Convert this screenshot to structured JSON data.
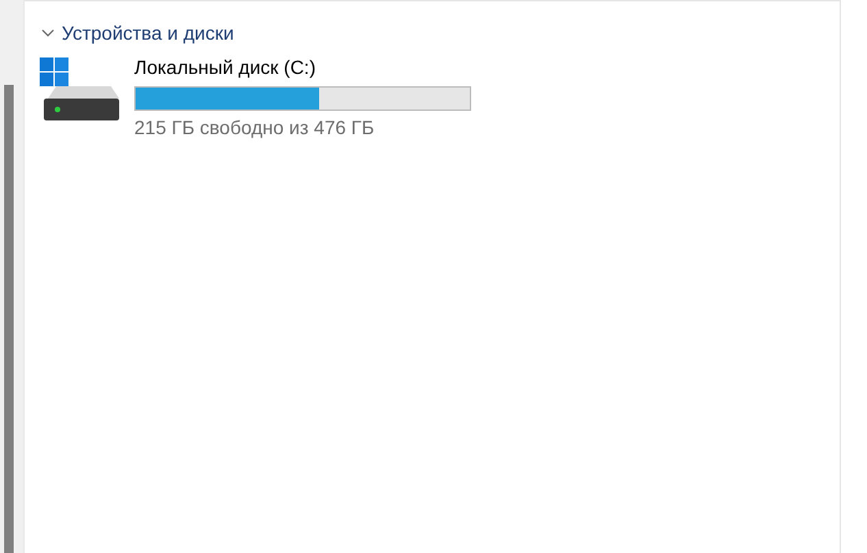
{
  "section": {
    "title": "Устройства и диски",
    "expanded": true
  },
  "drives": [
    {
      "name": "Локальный диск (C:)",
      "level": 0.55,
      "space": "215 ГБ свободно из 476 ГБ"
    }
  ]
}
